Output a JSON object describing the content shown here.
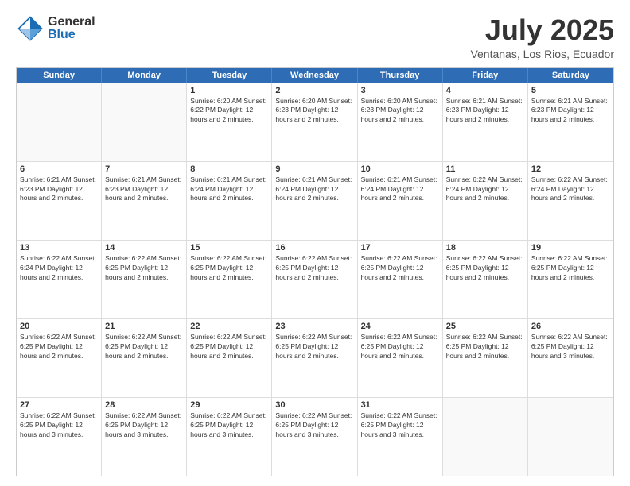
{
  "header": {
    "logo": {
      "general": "General",
      "blue": "Blue"
    },
    "title": "July 2025",
    "subtitle": "Ventanas, Los Rios, Ecuador"
  },
  "calendar": {
    "days": [
      "Sunday",
      "Monday",
      "Tuesday",
      "Wednesday",
      "Thursday",
      "Friday",
      "Saturday"
    ],
    "weeks": [
      [
        {
          "day": "",
          "text": ""
        },
        {
          "day": "",
          "text": ""
        },
        {
          "day": "1",
          "text": "Sunrise: 6:20 AM\nSunset: 6:22 PM\nDaylight: 12 hours and 2 minutes."
        },
        {
          "day": "2",
          "text": "Sunrise: 6:20 AM\nSunset: 6:23 PM\nDaylight: 12 hours and 2 minutes."
        },
        {
          "day": "3",
          "text": "Sunrise: 6:20 AM\nSunset: 6:23 PM\nDaylight: 12 hours and 2 minutes."
        },
        {
          "day": "4",
          "text": "Sunrise: 6:21 AM\nSunset: 6:23 PM\nDaylight: 12 hours and 2 minutes."
        },
        {
          "day": "5",
          "text": "Sunrise: 6:21 AM\nSunset: 6:23 PM\nDaylight: 12 hours and 2 minutes."
        }
      ],
      [
        {
          "day": "6",
          "text": "Sunrise: 6:21 AM\nSunset: 6:23 PM\nDaylight: 12 hours and 2 minutes."
        },
        {
          "day": "7",
          "text": "Sunrise: 6:21 AM\nSunset: 6:23 PM\nDaylight: 12 hours and 2 minutes."
        },
        {
          "day": "8",
          "text": "Sunrise: 6:21 AM\nSunset: 6:24 PM\nDaylight: 12 hours and 2 minutes."
        },
        {
          "day": "9",
          "text": "Sunrise: 6:21 AM\nSunset: 6:24 PM\nDaylight: 12 hours and 2 minutes."
        },
        {
          "day": "10",
          "text": "Sunrise: 6:21 AM\nSunset: 6:24 PM\nDaylight: 12 hours and 2 minutes."
        },
        {
          "day": "11",
          "text": "Sunrise: 6:22 AM\nSunset: 6:24 PM\nDaylight: 12 hours and 2 minutes."
        },
        {
          "day": "12",
          "text": "Sunrise: 6:22 AM\nSunset: 6:24 PM\nDaylight: 12 hours and 2 minutes."
        }
      ],
      [
        {
          "day": "13",
          "text": "Sunrise: 6:22 AM\nSunset: 6:24 PM\nDaylight: 12 hours and 2 minutes."
        },
        {
          "day": "14",
          "text": "Sunrise: 6:22 AM\nSunset: 6:25 PM\nDaylight: 12 hours and 2 minutes."
        },
        {
          "day": "15",
          "text": "Sunrise: 6:22 AM\nSunset: 6:25 PM\nDaylight: 12 hours and 2 minutes."
        },
        {
          "day": "16",
          "text": "Sunrise: 6:22 AM\nSunset: 6:25 PM\nDaylight: 12 hours and 2 minutes."
        },
        {
          "day": "17",
          "text": "Sunrise: 6:22 AM\nSunset: 6:25 PM\nDaylight: 12 hours and 2 minutes."
        },
        {
          "day": "18",
          "text": "Sunrise: 6:22 AM\nSunset: 6:25 PM\nDaylight: 12 hours and 2 minutes."
        },
        {
          "day": "19",
          "text": "Sunrise: 6:22 AM\nSunset: 6:25 PM\nDaylight: 12 hours and 2 minutes."
        }
      ],
      [
        {
          "day": "20",
          "text": "Sunrise: 6:22 AM\nSunset: 6:25 PM\nDaylight: 12 hours and 2 minutes."
        },
        {
          "day": "21",
          "text": "Sunrise: 6:22 AM\nSunset: 6:25 PM\nDaylight: 12 hours and 2 minutes."
        },
        {
          "day": "22",
          "text": "Sunrise: 6:22 AM\nSunset: 6:25 PM\nDaylight: 12 hours and 2 minutes."
        },
        {
          "day": "23",
          "text": "Sunrise: 6:22 AM\nSunset: 6:25 PM\nDaylight: 12 hours and 2 minutes."
        },
        {
          "day": "24",
          "text": "Sunrise: 6:22 AM\nSunset: 6:25 PM\nDaylight: 12 hours and 2 minutes."
        },
        {
          "day": "25",
          "text": "Sunrise: 6:22 AM\nSunset: 6:25 PM\nDaylight: 12 hours and 2 minutes."
        },
        {
          "day": "26",
          "text": "Sunrise: 6:22 AM\nSunset: 6:25 PM\nDaylight: 12 hours and 3 minutes."
        }
      ],
      [
        {
          "day": "27",
          "text": "Sunrise: 6:22 AM\nSunset: 6:25 PM\nDaylight: 12 hours and 3 minutes."
        },
        {
          "day": "28",
          "text": "Sunrise: 6:22 AM\nSunset: 6:25 PM\nDaylight: 12 hours and 3 minutes."
        },
        {
          "day": "29",
          "text": "Sunrise: 6:22 AM\nSunset: 6:25 PM\nDaylight: 12 hours and 3 minutes."
        },
        {
          "day": "30",
          "text": "Sunrise: 6:22 AM\nSunset: 6:25 PM\nDaylight: 12 hours and 3 minutes."
        },
        {
          "day": "31",
          "text": "Sunrise: 6:22 AM\nSunset: 6:25 PM\nDaylight: 12 hours and 3 minutes."
        },
        {
          "day": "",
          "text": ""
        },
        {
          "day": "",
          "text": ""
        }
      ]
    ]
  }
}
